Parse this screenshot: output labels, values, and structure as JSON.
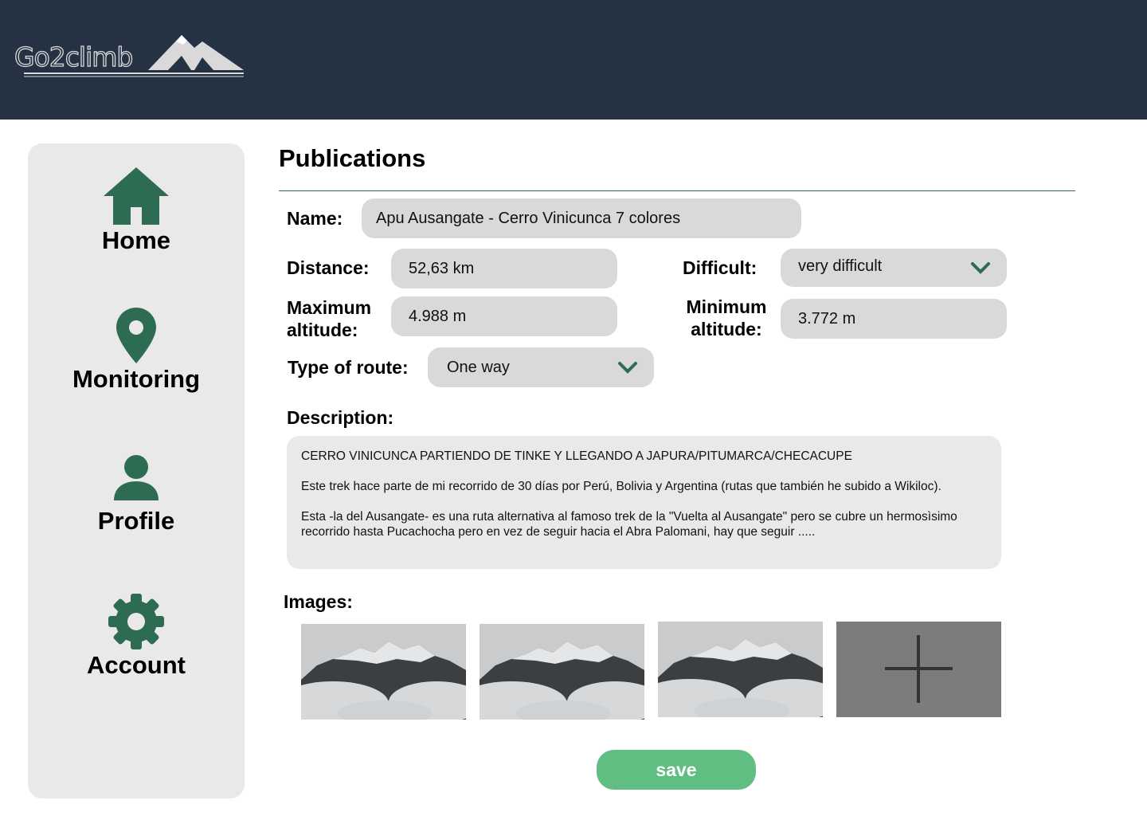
{
  "app": {
    "logo_text": "Go2climb",
    "header_color": "#243243",
    "accent_color": "#2e6b53",
    "save_color": "#61be83"
  },
  "sidebar": {
    "items": [
      {
        "label": "Home",
        "icon": "home-icon"
      },
      {
        "label": "Monitoring",
        "icon": "map-pin-icon"
      },
      {
        "label": "Profile",
        "icon": "user-icon"
      },
      {
        "label": "Account",
        "icon": "gear-icon"
      }
    ]
  },
  "page": {
    "title": "Publications"
  },
  "form": {
    "name_label": "Name:",
    "name_value": "Apu Ausangate - Cerro Vinicunca 7 colores",
    "distance_label": "Distance:",
    "distance_value": "52,63 km",
    "difficult_label": "Difficult:",
    "difficult_value": "very difficult",
    "max_alt_label_1": "Maximum",
    "max_alt_label_2": "altitude:",
    "max_alt_value": "4.988 m",
    "min_alt_label_1": "Minimum",
    "min_alt_label_2": "altitude:",
    "min_alt_value": "3.772 m",
    "route_label": "Type of route:",
    "route_value": "One way",
    "description_label": "Description:",
    "description_paragraphs": [
      "CERRO VINICUNCA PARTIENDO DE TINKE Y LLEGANDO A JAPURA/PITUMARCA/CHECACUPE",
      "Este trek hace parte de mi recorrido de 30 días por Perú, Bolivia y Argentina (rutas que también he subido a Wikiloc).",
      "Esta -la del Ausangate- es una ruta alternativa al famoso trek de la \"Vuelta al Ausangate\" pero se cubre un hermosìsimo recorrido hasta Pucachocha pero en vez de seguir hacia el Abra Palomani, hay que seguir ....."
    ],
    "images_label": "Images:",
    "images": [
      "mountain-photo",
      "mountain-photo",
      "mountain-photo"
    ],
    "add_image_icon": "plus-icon",
    "save_label": "save"
  }
}
